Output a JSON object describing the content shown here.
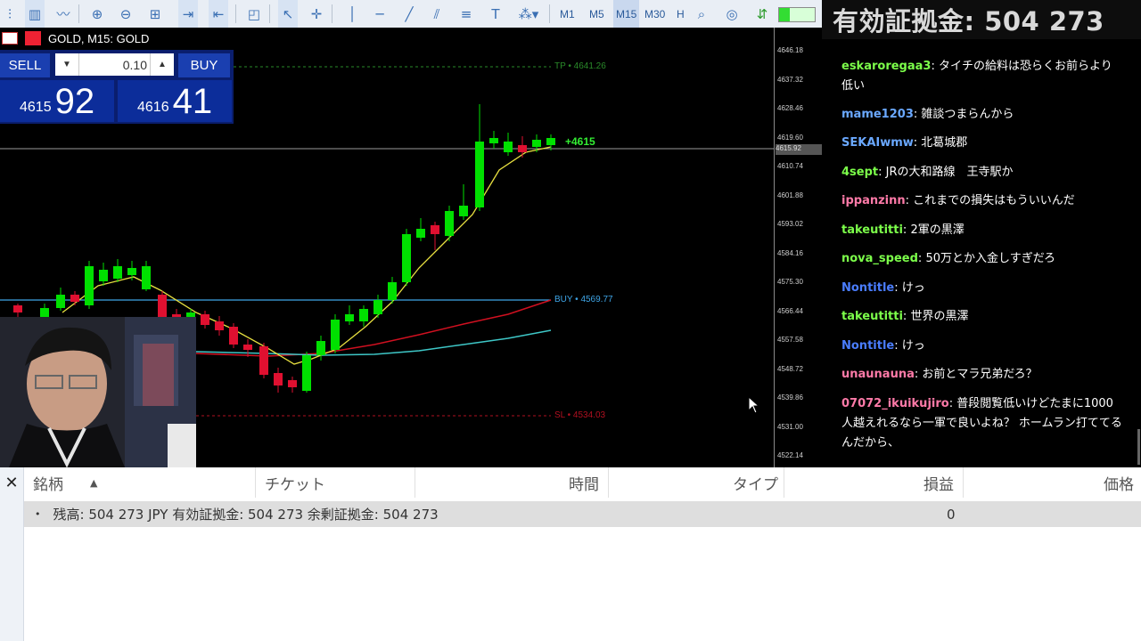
{
  "toolbar": {
    "timeframes": [
      "M1",
      "M5",
      "M15",
      "M30",
      "H"
    ],
    "active_timeframe": "M15"
  },
  "banner": {
    "text": "有効証拠金: 504 273"
  },
  "chart": {
    "title": "GOLD, M15: GOLD",
    "trade_panel": {
      "sell_label": "SELL",
      "buy_label": "BUY",
      "lot_value": "0.10",
      "bid_small": "4615",
      "bid_big": "92",
      "ask_small": "4616",
      "ask_big": "41"
    },
    "price_ticks": [
      "4646.18",
      "4637.32",
      "4628.46",
      "4619.60",
      "4610.74",
      "4601.88",
      "4593.02",
      "4584.16",
      "4575.30",
      "4566.44",
      "4557.58",
      "4548.72",
      "4539.86",
      "4531.00",
      "4522.14"
    ],
    "current_price_label": "4615.92",
    "lines": {
      "tp_label": "TP • 4641.26",
      "buy_label": "BUY • 4569.77",
      "sl_label": "SL • 4534.03",
      "pnl_label": "+4615"
    },
    "colors": {
      "up": "#00e000",
      "down": "#e01030",
      "tp": "#2a8a2a",
      "buy": "#3fa6e8",
      "sl": "#b01020"
    }
  },
  "chat": {
    "messages": [
      {
        "user": "",
        "text": ""
      },
      {
        "user": "eskaroregaa3",
        "text": "タイチの給料は恐らくお前らより低い",
        "color": "#7cff4a"
      },
      {
        "user": "mame1203",
        "text": "雑談つまらんから",
        "color": "#6aa8ff"
      },
      {
        "user": "SEKAIwmw",
        "text": "北葛城郡",
        "color": "#6aa8ff"
      },
      {
        "user": "4sept",
        "text": "JRの大和路線　王寺駅か",
        "color": "#7cff4a"
      },
      {
        "user": "ippanzinn",
        "text": "これまでの損失はもういいんだ",
        "color": "#ff7aa8"
      },
      {
        "user": "takeutitti",
        "text": "2軍の黒澤",
        "color": "#7cff4a"
      },
      {
        "user": "nova_speed",
        "text": "50万とか入金しすぎだろ",
        "color": "#7cff4a"
      },
      {
        "user": "Nontitle",
        "text": "けっ",
        "color": "#4a7dff"
      },
      {
        "user": "takeutitti",
        "text": "世界の黒澤",
        "color": "#7cff4a"
      },
      {
        "user": "Nontitle",
        "text": "けっ",
        "color": "#4a7dff"
      },
      {
        "user": "unaunauna",
        "text": "お前とマラ兄弟だろ？",
        "color": "#ff7aa8"
      },
      {
        "user": "07072_ikuikujiro",
        "text": "普段閲覧低いけどたまに1000人越えれるなら一軍で良いよね？ ホームラン打ててるんだから、",
        "color": "#ff7aa8"
      }
    ]
  },
  "terminal": {
    "headers": [
      "銘柄",
      "チケット",
      "時間",
      "タイプ",
      "損益",
      "価格"
    ],
    "balance_text": "残高: 504 273 JPY  有効証拠金: 504 273  余剰証拠金: 504 273",
    "profit": "0"
  }
}
